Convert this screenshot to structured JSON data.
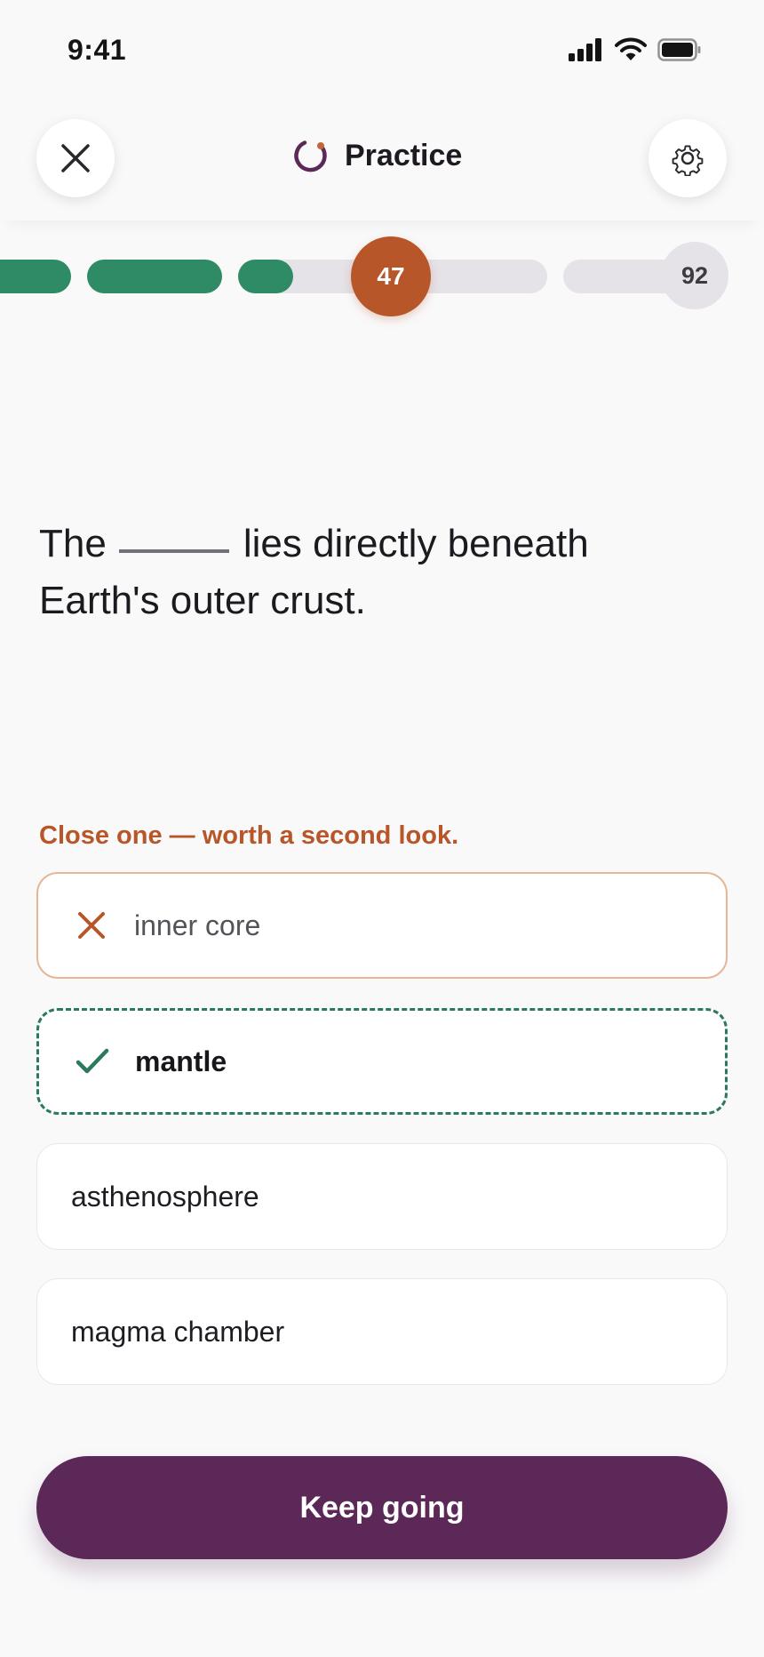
{
  "status_bar": {
    "time": "9:41"
  },
  "header": {
    "title": "Practice",
    "close_icon": "close-icon",
    "settings_icon": "gear-icon",
    "logo_icon": "progress-ring-icon"
  },
  "progress": {
    "current_label": "47",
    "goal_label": "92",
    "current_value": 47,
    "goal_value": 92
  },
  "question": {
    "before_blank": "The",
    "after_blank": "lies directly beneath Earth's outer crust."
  },
  "feedback": {
    "text": "Close one — worth a second look."
  },
  "options": [
    {
      "label": "inner core",
      "state": "incorrect-selected"
    },
    {
      "label": "mantle",
      "state": "correct-answer"
    },
    {
      "label": "asthenosphere",
      "state": "default"
    },
    {
      "label": "magma chamber",
      "state": "default"
    }
  ],
  "cta": {
    "label": "Keep going"
  },
  "colors": {
    "accent": "#5b2857",
    "correct": "#2e8b65",
    "incorrect": "#b75628",
    "track": "#e5e2e8"
  }
}
